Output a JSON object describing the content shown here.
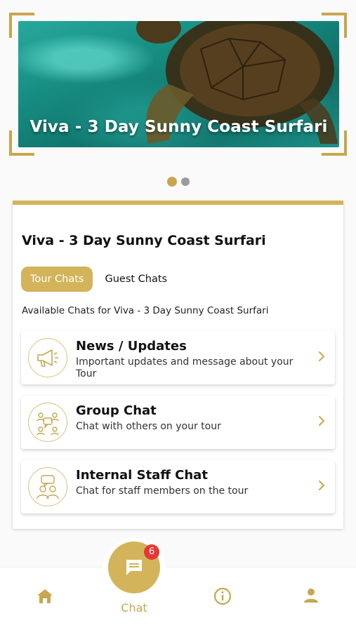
{
  "hero": {
    "title": "Viva - 3 Day Sunny Coast Surfari",
    "pages_total": 2,
    "active_page": 1
  },
  "card": {
    "title": "Viva - 3 Day Sunny Coast Surfari",
    "tabs": [
      {
        "label": "Tour Chats",
        "active": true
      },
      {
        "label": "Guest Chats",
        "active": false
      }
    ],
    "available_text": "Available Chats for Viva - 3 Day Sunny Coast Surfari",
    "chats": [
      {
        "title": "News / Updates",
        "subtitle": "Important updates and message about your Tour",
        "icon": "megaphone-icon"
      },
      {
        "title": "Group Chat",
        "subtitle": "Chat with others on your tour",
        "icon": "group-chat-icon"
      },
      {
        "title": "Internal Staff Chat",
        "subtitle": "Chat for staff members on the tour",
        "icon": "staff-chat-icon"
      }
    ]
  },
  "nav": {
    "chat_label": "Chat",
    "chat_badge": "6",
    "items": [
      "home-icon",
      "chat-icon",
      "info-icon",
      "profile-icon"
    ]
  },
  "colors": {
    "accent": "#d4b45a",
    "accent_text": "#c9a64d",
    "badge": "#e53935"
  }
}
